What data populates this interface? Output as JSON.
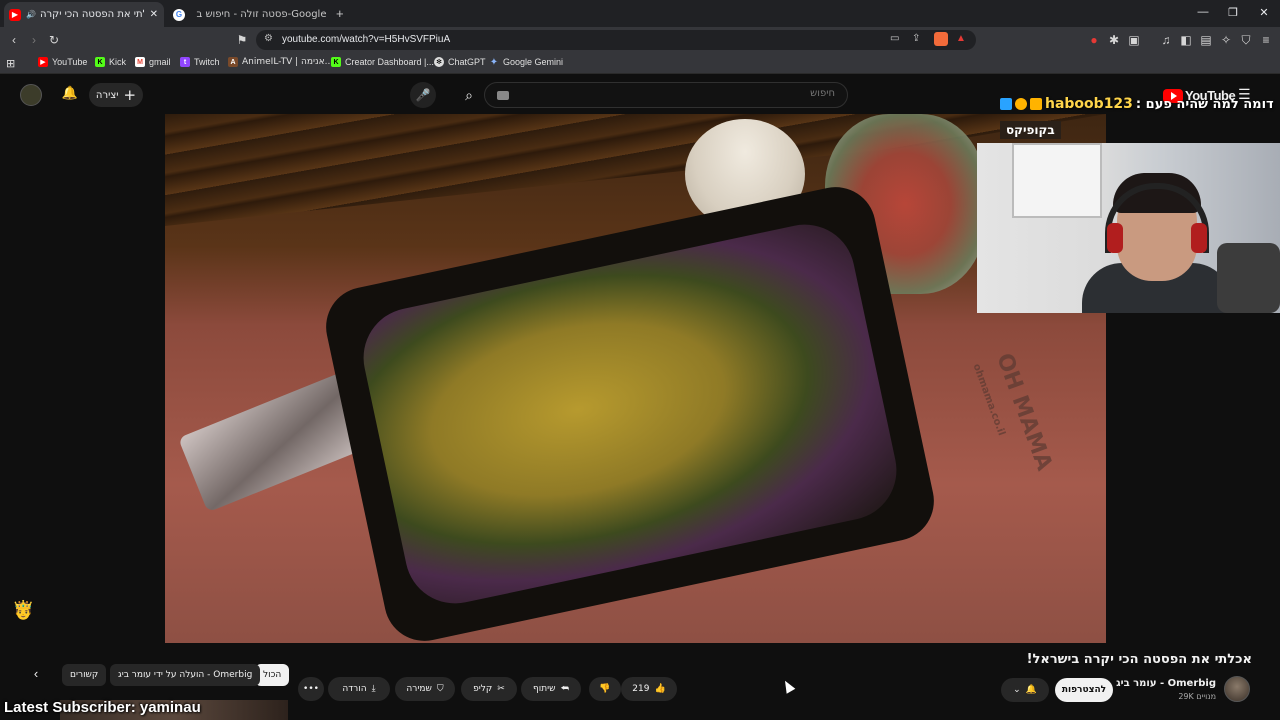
{
  "browser": {
    "tabs": [
      {
        "title": "אכלתי את הפסטה הכי יקרה :",
        "active": true
      },
      {
        "title": "פסטה זולה - חיפוש ב-Google",
        "active": false
      }
    ],
    "new_tab_icon": "plus-icon",
    "url": "youtube.com/watch?v=H5HvSVFPiuA",
    "bookmarks": [
      "YouTube",
      "Kick",
      "gmail",
      "Twitch",
      "AnimeIL-TV | אנימה...",
      "Creator Dashboard |...",
      "ChatGPT",
      "Google Gemini"
    ]
  },
  "youtube": {
    "logo_text": "YouTube",
    "search_placeholder": "חיפוש",
    "create_label": "יצירה",
    "video": {
      "brand_text": "OH MAMA",
      "brand_sub": "ohmama.co.il",
      "title": "אכלתי את הפסטה הכי יקרה בישראל!",
      "channel_name": "עומר ביג - Omerbig",
      "subscribers": "29K מנויים",
      "subscribe_label": "להצטרפות",
      "likes": "219",
      "share_label": "שיתוף",
      "clip_label": "קליפ",
      "save_label": "שמירה",
      "download_label": "הורדה"
    },
    "chips": [
      "הכול",
      "הועלה על ידי עומר ביג - Omerbig",
      "קשורים"
    ]
  },
  "overlay": {
    "title_name": "haboob123",
    "title_rest": "דומה למה שהיה פעם :",
    "tag": "בקופיקס",
    "latest_subscriber": "Latest Subscriber: yaminau"
  },
  "colors": {
    "accent_red": "#ff0000",
    "overlay_yellow": "#ffd54a",
    "bg": "#0f0f0f"
  }
}
